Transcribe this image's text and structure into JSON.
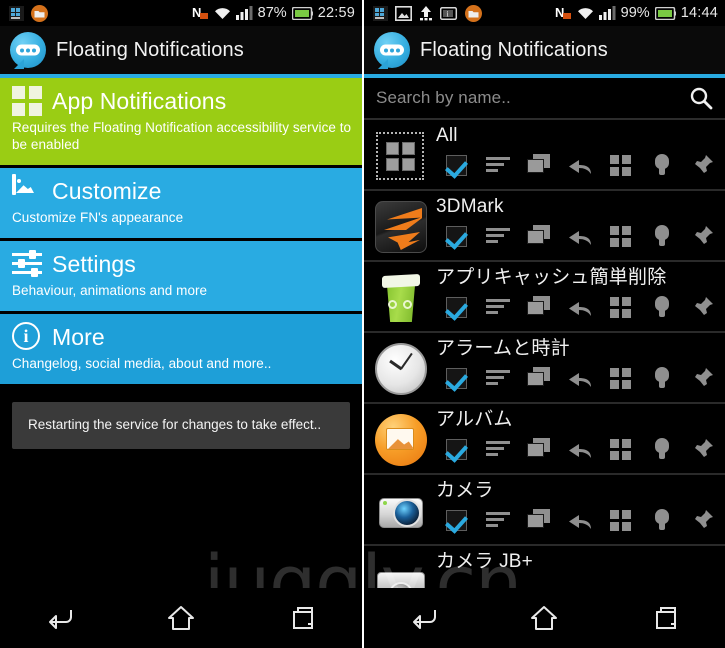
{
  "watermark": {
    "text": "juggly.cn"
  },
  "left_panel": {
    "status_bar": {
      "left_icons": [
        "grid-notification-icon",
        "folder-notification-icon"
      ],
      "nfc_icon": "nfc-icon",
      "wifi_icon": "wifi-icon",
      "signal_icon": "signal-bars-icon",
      "battery_percent": "87%",
      "battery_icon": "battery-icon",
      "clock": "22:59"
    },
    "title_bar": {
      "logo": "floating-notifications-logo",
      "title": "Floating Notifications"
    },
    "menu": [
      {
        "id": "app-notifications",
        "icon": "grid-squares-icon",
        "title": "App Notifications",
        "subtitle": "Requires the Floating Notification accessibility service to be enabled",
        "color": "#9acd14"
      },
      {
        "id": "customize",
        "icon": "image-icon",
        "title": "Customize",
        "subtitle": "Customize FN's appearance",
        "color": "#29abe2"
      },
      {
        "id": "settings",
        "icon": "sliders-icon",
        "title": "Settings",
        "subtitle": "Behaviour, animations and more",
        "color": "#29abe2"
      },
      {
        "id": "more",
        "icon": "info-circle-icon",
        "title": "More",
        "subtitle": "Changelog, social media, about and more..",
        "color": "#1e9fd8"
      }
    ],
    "toast": {
      "message": "Restarting the service for changes to take effect.."
    },
    "nav_bar": {
      "back": "back-icon",
      "home": "home-icon",
      "recents": "recents-icon"
    }
  },
  "right_panel": {
    "status_bar": {
      "left_icons": [
        "grid-notification-icon",
        "image-notification-icon",
        "upload-notification-icon",
        "info-notification-icon",
        "folder-notification-icon"
      ],
      "nfc_icon": "nfc-icon",
      "wifi_icon": "wifi-icon",
      "signal_icon": "signal-bars-icon",
      "battery_percent": "99%",
      "battery_icon": "battery-icon",
      "clock": "14:44"
    },
    "title_bar": {
      "logo": "floating-notifications-logo",
      "title": "Floating Notifications"
    },
    "search": {
      "placeholder": "Search by name..",
      "value": "",
      "icon": "search-icon"
    },
    "action_icons": [
      "checkbox",
      "list-lines-icon",
      "stack-icon",
      "reply-arrow-icon",
      "grid-icon",
      "lightbulb-icon",
      "pin-icon"
    ],
    "apps": [
      {
        "name": "All",
        "icon": "all-apps-icon",
        "checked": true
      },
      {
        "name": "3DMark",
        "icon": "3dmark-icon",
        "checked": true
      },
      {
        "name": "アプリキャッシュ簡単削除",
        "icon": "cache-cleaner-icon",
        "checked": true
      },
      {
        "name": "アラームと時計",
        "icon": "clock-icon",
        "checked": true
      },
      {
        "name": "アルバム",
        "icon": "album-icon",
        "checked": true
      },
      {
        "name": "カメラ",
        "icon": "camera-icon",
        "checked": true
      },
      {
        "name": "カメラ JB+",
        "icon": "camera-jb-icon",
        "checked": true
      }
    ],
    "nav_bar": {
      "back": "back-icon",
      "home": "home-icon",
      "recents": "recents-icon"
    }
  }
}
